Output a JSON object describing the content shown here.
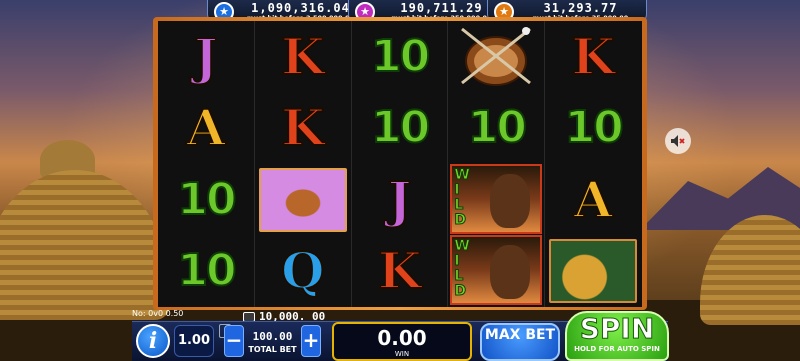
{
  "jackpots": [
    {
      "value": "1,090,316.04",
      "note": "must hit before 2,500,000.00",
      "color": "#1b6fe0"
    },
    {
      "value": "190,711.29",
      "note": "must hit before 250,000.00",
      "color": "#c02cc0"
    },
    {
      "value": "31,293.77",
      "note": "must hit before 35,000.00",
      "color": "#e07a10"
    }
  ],
  "reels": [
    [
      "J",
      "A",
      "10",
      "10"
    ],
    [
      "K",
      "K",
      "antelope",
      "Q"
    ],
    [
      "10",
      "10",
      "J",
      "K"
    ],
    [
      "shield",
      "10",
      "wild",
      "wild"
    ],
    [
      "K",
      "10",
      "A",
      "leopard"
    ]
  ],
  "wild_label": "WILD",
  "game_info": "No: 0v0 0.50",
  "balance": "10,000. 00",
  "coin_value": "1.00",
  "total_bet": {
    "value": "100.00",
    "label": "TOTAL BET"
  },
  "win": {
    "value": "0.00",
    "label": "WIN"
  },
  "buttons": {
    "info": "i",
    "minus": "−",
    "plus": "+",
    "max_bet": "MAX BET",
    "spin": "SPIN",
    "spin_sub": "HOLD FOR AUTO SPIN"
  },
  "icons": {
    "jackpot": "star-icon",
    "sound": "speaker-muted-icon",
    "balance": "coins-icon"
  },
  "colors": {
    "frame": "#e08a2a",
    "spin": "#3cc818",
    "max_bet": "#1f66e0",
    "win_border": "#e6b400"
  }
}
